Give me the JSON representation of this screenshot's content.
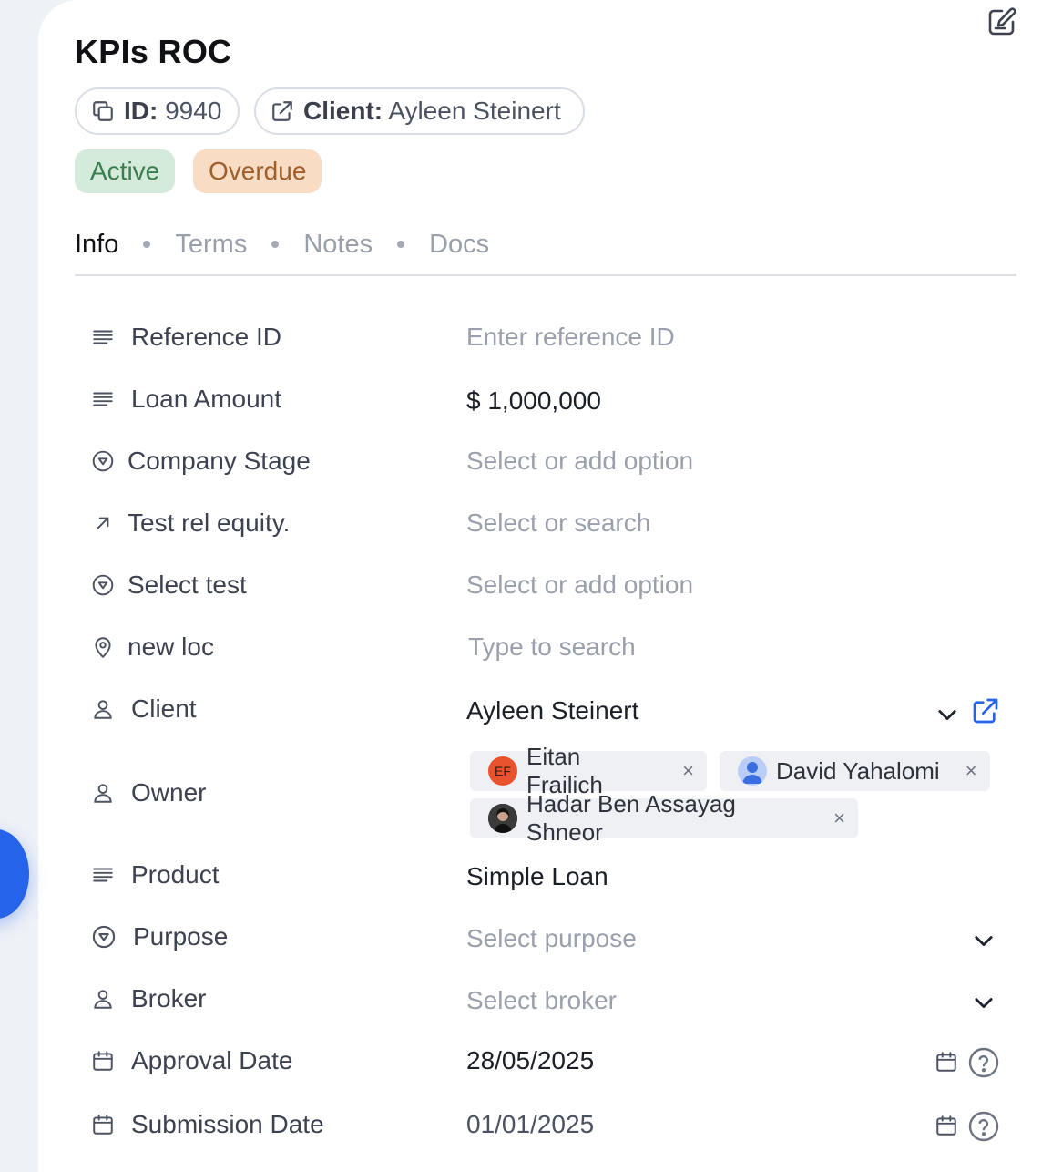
{
  "header": {
    "title": "KPIs ROC",
    "id_label": "ID:",
    "id_value": "9940",
    "client_label": "Client:",
    "client_value": "Ayleen Steinert",
    "statuses": [
      "Active",
      "Overdue"
    ]
  },
  "tabs": [
    "Info",
    "Terms",
    "Notes",
    "Docs"
  ],
  "active_tab": "Info",
  "fields": {
    "reference_id": {
      "label": "Reference ID",
      "placeholder": "Enter reference ID"
    },
    "loan_amount": {
      "label": "Loan Amount",
      "value": "$ 1,000,000"
    },
    "company_stage": {
      "label": "Company Stage",
      "placeholder": "Select or add option"
    },
    "test_rel_equity": {
      "label": "Test rel equity.",
      "placeholder": "Select or search"
    },
    "select_test": {
      "label": "Select test",
      "placeholder": "Select or add option"
    },
    "new_loc": {
      "label": "new loc",
      "placeholder": "Type to search"
    },
    "client": {
      "label": "Client",
      "value": "Ayleen Steinert"
    },
    "owner": {
      "label": "Owner",
      "tags": [
        {
          "name": "Eitan Frailich",
          "initials": "EF",
          "remove": "×"
        },
        {
          "name": "David Yahalomi",
          "remove": "×"
        },
        {
          "name": "Hadar Ben Assayag Shneor",
          "remove": "×"
        }
      ]
    },
    "product": {
      "label": "Product",
      "value": "Simple Loan"
    },
    "purpose": {
      "label": "Purpose",
      "placeholder": "Select purpose"
    },
    "broker": {
      "label": "Broker",
      "placeholder": "Select broker"
    },
    "approval_date": {
      "label": "Approval Date",
      "value": "28/05/2025"
    },
    "submission_date": {
      "label": "Submission Date",
      "value": "01/01/2025"
    }
  },
  "colors": {
    "accent": "#2563eb",
    "active_bg": "#d4eadb",
    "active_text": "#3b7d4e",
    "overdue_bg": "#f8dcc4",
    "overdue_text": "#a05f2a"
  },
  "icons": {
    "edit": "edit-note-icon",
    "copy": "copy-icon",
    "external": "external-link-icon",
    "text": "text-lines-icon",
    "select": "dropdown-circle-icon",
    "relation": "arrow-up-right-icon",
    "location": "map-pin-icon",
    "person": "person-icon",
    "calendar": "calendar-icon",
    "help": "help-circle-icon",
    "chevron": "chevron-down-icon"
  }
}
